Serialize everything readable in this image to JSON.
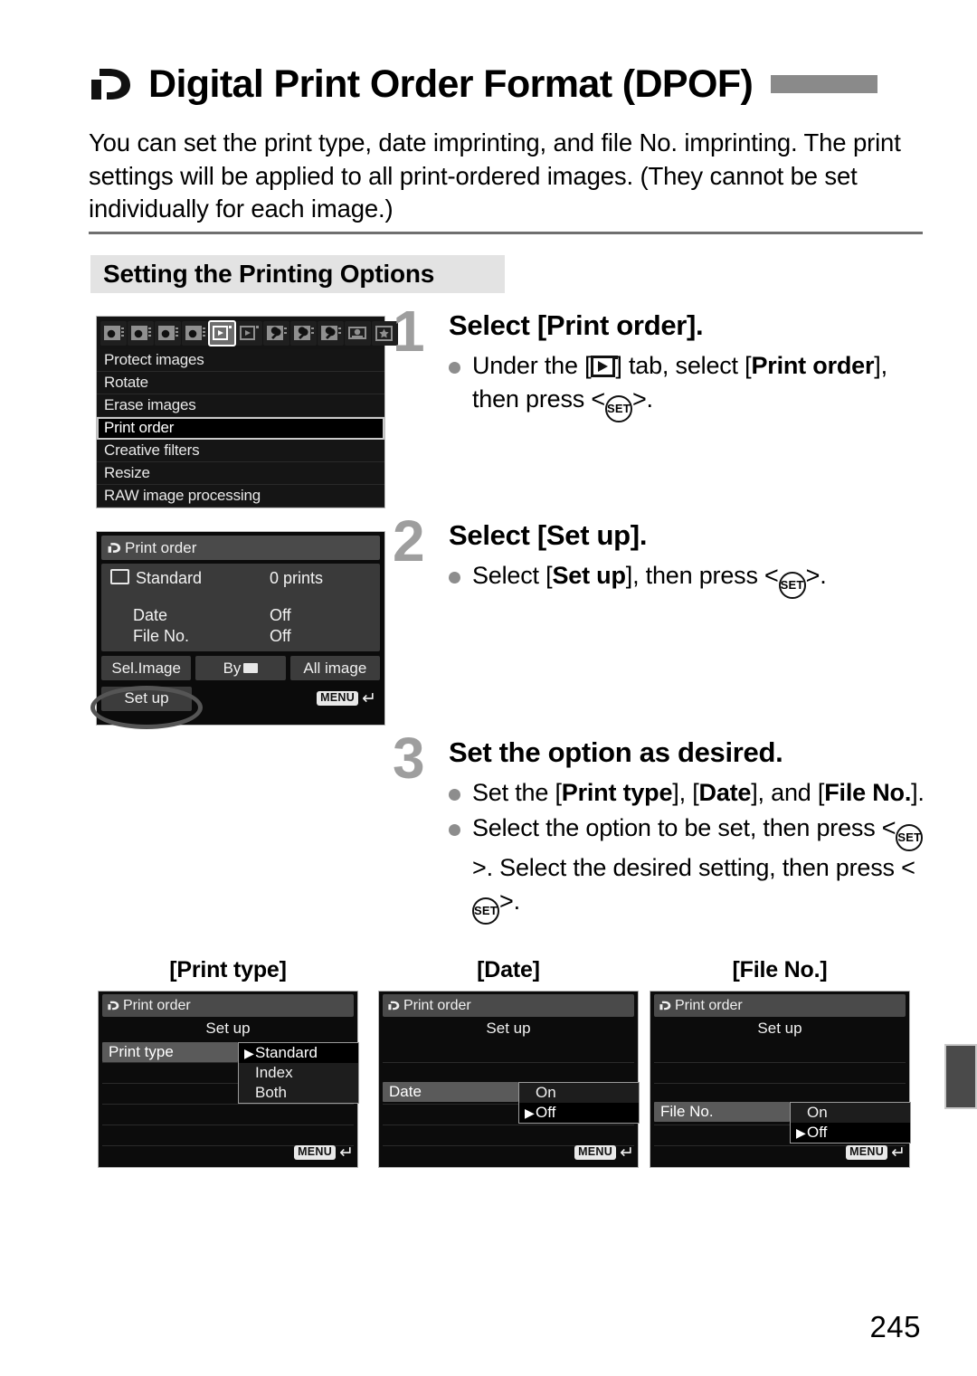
{
  "page": {
    "title": "Digital Print Order Format (DPOF)",
    "title_icon": "dpof-icon",
    "intro": "You can set the print type, date imprinting, and file No. imprinting. The print settings will be applied to all print-ordered images. (They cannot be set individually for each image.)",
    "section_heading": "Setting the Printing Options",
    "page_number": "245"
  },
  "menu_screenshot": {
    "tabs": [
      {
        "icon": "camera-tab-icon-1",
        "active": false
      },
      {
        "icon": "camera-tab-icon-2",
        "active": false
      },
      {
        "icon": "camera-tab-icon-3",
        "active": false
      },
      {
        "icon": "camera-tab-icon-4",
        "active": false
      },
      {
        "icon": "playback-tab-icon-1",
        "active": true
      },
      {
        "icon": "playback-tab-icon-2",
        "active": false
      },
      {
        "icon": "wrench-tab-icon-1",
        "active": false
      },
      {
        "icon": "wrench-tab-icon-2",
        "active": false
      },
      {
        "icon": "wrench-tab-icon-3",
        "active": false
      },
      {
        "icon": "custom-tab-icon",
        "active": false
      },
      {
        "icon": "my-menu-star-icon",
        "active": false
      }
    ],
    "items": [
      {
        "label": "Protect images",
        "selected": false
      },
      {
        "label": "Rotate",
        "selected": false
      },
      {
        "label": "Erase images",
        "selected": false
      },
      {
        "label": "Print order",
        "selected": true
      },
      {
        "label": "Creative filters",
        "selected": false
      },
      {
        "label": "Resize",
        "selected": false
      },
      {
        "label": "RAW image processing",
        "selected": false
      }
    ]
  },
  "print_order_screenshot": {
    "titlebar": "Print order",
    "titlebar_icon": "dpof-icon",
    "standard_label": "Standard",
    "standard_icon": "standard-print-icon",
    "standard_value": "0 prints",
    "date_label": "Date",
    "date_value": "Off",
    "fileno_label": "File No.",
    "fileno_value": "Off",
    "buttons": [
      "Sel.Image",
      "By",
      "All image"
    ],
    "by_folder_icon": "folder-icon",
    "setup_button": "Set up",
    "menu_chip": "MENU",
    "return_arrow": "↵",
    "highlight": "set-up-circled"
  },
  "steps": [
    {
      "number": "1",
      "title": "Select [Print order].",
      "bullets": [
        {
          "parts": [
            {
              "t": "Under the [",
              "bold": false
            },
            {
              "t": "PLAYBACK_TAB_ICON",
              "icon": "playback-tab-icon"
            },
            {
              "t": "] tab, select [",
              "bold": false
            },
            {
              "t": "Print order",
              "bold": true
            },
            {
              "t": "], then press <",
              "bold": false
            },
            {
              "t": "SET_ICON",
              "icon": "set-button-icon"
            },
            {
              "t": ">.",
              "bold": false
            }
          ]
        }
      ]
    },
    {
      "number": "2",
      "title": "Select [Set up].",
      "bullets": [
        {
          "parts": [
            {
              "t": "Select [",
              "bold": false
            },
            {
              "t": "Set up",
              "bold": true
            },
            {
              "t": "], then press <",
              "bold": false
            },
            {
              "t": "SET_ICON",
              "icon": "set-button-icon"
            },
            {
              "t": ">.",
              "bold": false
            }
          ]
        }
      ]
    },
    {
      "number": "3",
      "title": "Set the option as desired.",
      "bullets": [
        {
          "parts": [
            {
              "t": "Set the [",
              "bold": false
            },
            {
              "t": "Print type",
              "bold": true
            },
            {
              "t": "], [",
              "bold": false
            },
            {
              "t": "Date",
              "bold": true
            },
            {
              "t": "], and [",
              "bold": false
            },
            {
              "t": "File No.",
              "bold": true
            },
            {
              "t": "].",
              "bold": false
            }
          ]
        },
        {
          "parts": [
            {
              "t": "Select the option to be set, then press <",
              "bold": false
            },
            {
              "t": "SET_ICON",
              "icon": "set-button-icon"
            },
            {
              "t": ">. Select the desired setting, then press <",
              "bold": false
            },
            {
              "t": "SET_ICON",
              "icon": "set-button-icon"
            },
            {
              "t": ">.",
              "bold": false
            }
          ]
        }
      ]
    }
  ],
  "setup_panels": [
    {
      "caption": "[Print type]",
      "titlebar": "Print order",
      "subtitle": "Set up",
      "label": "Print type",
      "label_row": 1,
      "options": [
        {
          "text": "Standard",
          "selected": true
        },
        {
          "text": "Index",
          "selected": false
        },
        {
          "text": "Both",
          "selected": false
        }
      ],
      "menu_chip": "MENU",
      "return_arrow": "↵"
    },
    {
      "caption": "[Date]",
      "titlebar": "Print order",
      "subtitle": "Set up",
      "label": "Date",
      "label_row": 3,
      "options": [
        {
          "text": "On",
          "selected": false
        },
        {
          "text": "Off",
          "selected": true
        }
      ],
      "menu_chip": "MENU",
      "return_arrow": "↵"
    },
    {
      "caption": "[File No.]",
      "titlebar": "Print order",
      "subtitle": "Set up",
      "label": "File No.",
      "label_row": 4,
      "options": [
        {
          "text": "On",
          "selected": false
        },
        {
          "text": "Off",
          "selected": true
        }
      ],
      "menu_chip": "MENU",
      "return_arrow": "↵"
    }
  ],
  "colors": {
    "heading_bg": "#e3e3e3",
    "rule": "#6f6f6f",
    "step_number": "#9e9e9e",
    "bullet": "#8d8d8d",
    "lcd_bg": "#0b0b0b",
    "lcd_title": "#4a4a4a",
    "edge_tab": "#4a4a4a"
  }
}
